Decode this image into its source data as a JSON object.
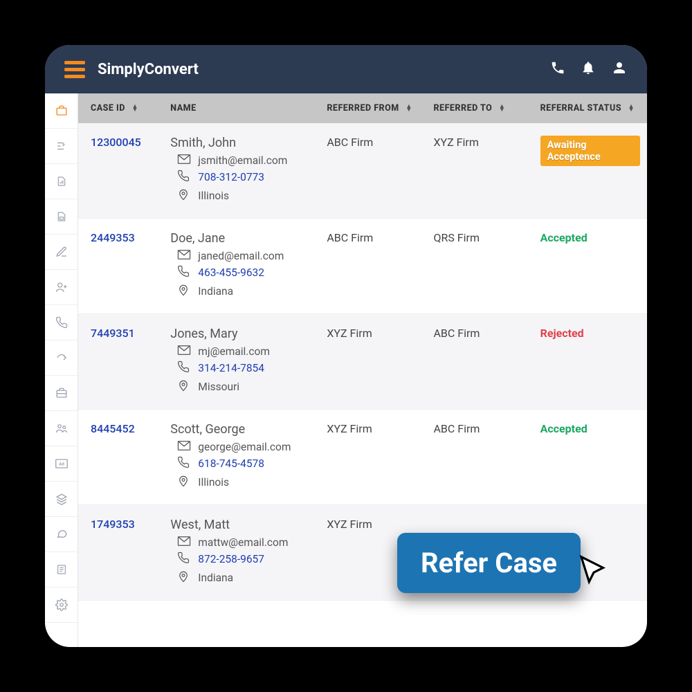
{
  "app": {
    "title": "SimplyConvert"
  },
  "columns": {
    "caseid": "CASE ID",
    "name": "NAME",
    "from": "REFERRED FROM",
    "to": "REFERRED TO",
    "status": "REFERRAL STATUS"
  },
  "rows": [
    {
      "case_id": "12300045",
      "name": "Smith, John",
      "email": "jsmith@email.com",
      "phone": "708-312-0773",
      "location": "Illinois",
      "from": "ABC Firm",
      "to": "XYZ Firm",
      "status": "Awaiting Acceptence",
      "status_type": "badge"
    },
    {
      "case_id": "2449353",
      "name": "Doe, Jane",
      "email": "janed@email.com",
      "phone": "463-455-9632",
      "location": "Indiana",
      "from": "ABC Firm",
      "to": "QRS Firm",
      "status": "Accepted",
      "status_type": "accepted"
    },
    {
      "case_id": "7449351",
      "name": "Jones, Mary",
      "email": "mj@email.com",
      "phone": "314-214-7854",
      "location": "Missouri",
      "from": "XYZ Firm",
      "to": "ABC Firm",
      "status": "Rejected",
      "status_type": "rejected"
    },
    {
      "case_id": "8445452",
      "name": "Scott, George",
      "email": "george@email.com",
      "phone": "618-745-4578",
      "location": "Illinois",
      "from": "XYZ Firm",
      "to": "ABC Firm",
      "status": "Accepted",
      "status_type": "accepted"
    },
    {
      "case_id": "1749353",
      "name": "West, Matt",
      "email": "mattw@email.com",
      "phone": "872-258-9657",
      "location": "Indiana",
      "from": "XYZ Firm",
      "to": "",
      "status": "",
      "status_type": ""
    }
  ],
  "cta": {
    "label": "Refer Case"
  }
}
